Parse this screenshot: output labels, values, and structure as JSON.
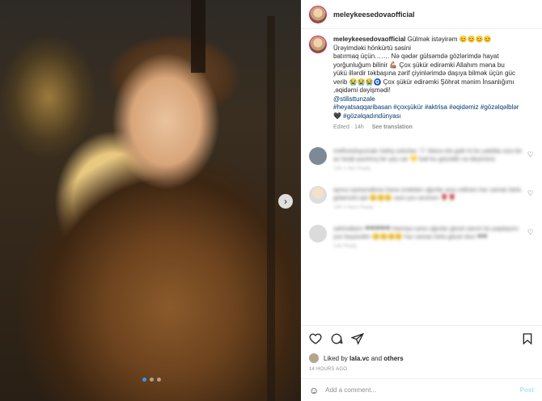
{
  "post": {
    "username": "meleykeesedovaofficial",
    "caption_user": "meleykeesedovaofficial",
    "caption_lines": [
      " Gülmək istəyirəm 😊😊😊😊",
      "Ürəyimdəki hönkürtü səsini",
      "batırmaq üçün……. Nə qədər gülsəmdə gözlərimdə hayat",
      "yorğunluğum bilinir 💪🏽 Çox şükür edirəmki Allahım məna bu",
      "yükü illərdir təkbaşına zərif çiyinlərimdə daşıya bilmək üçün güc",
      "verib 😭😭😭🧿 Çox şükür edirəmki Şöhrət mənim İnsanlığımı",
      ",əqidəmi dəyişmədi!"
    ],
    "mention": "@stilisttunzale",
    "hashtags_line1": "#heyatsaqqaribasan #çoxşükür #aktrisa #əqidəmiz #gözəlqəlblər",
    "hashtags_line2": "🖤 #gözəlqadındünyası",
    "edited": "Edited · 14h",
    "see_translation": "See translation"
  },
  "comments": [
    {
      "text": "melhutuluyumak Xahiş solurlaz 🤍 Mənə elə gəlir ki bu şəkildə sizə bir az fərqli yazılmış bir şey var 💛 bəli bu gözəldir nə deyirsiniz",
      "meta": "14h  1 like  Reply"
    },
    {
      "text": "aynur.vazeynalova Sənə ürəkdən uğurlar arzu edirəm hər zaman belə gülərüzlü qal 😊😊😊 səni çox sevirəm 🌹🌹",
      "meta": "14h  2 likes  Reply"
    },
    {
      "text": "sahinaliyev ❤❤❤❤❤ Həmişə sənə uğurlar gözəl xanım bu paylaşımı çox bəyəndim 😊😊😊😊 hər zaman belə gözəl olun ❤❤",
      "meta": "14h  Reply"
    }
  ],
  "likes": {
    "prefix": "Liked by ",
    "user": "lala.vc",
    "middle": " and ",
    "others": "others"
  },
  "timestamp": "14 HOURS AGO",
  "add_comment": {
    "placeholder": "Add a comment...",
    "post_label": "Post"
  },
  "icons": {
    "heart": "heart-icon",
    "comment": "comment-icon",
    "share": "share-icon",
    "save": "bookmark-icon",
    "emoji": "smiley-icon",
    "next": "chevron-right-icon"
  },
  "colors": {
    "link": "#00376b",
    "post_button": "#b2dffc",
    "active_dot": "#3897f0"
  }
}
